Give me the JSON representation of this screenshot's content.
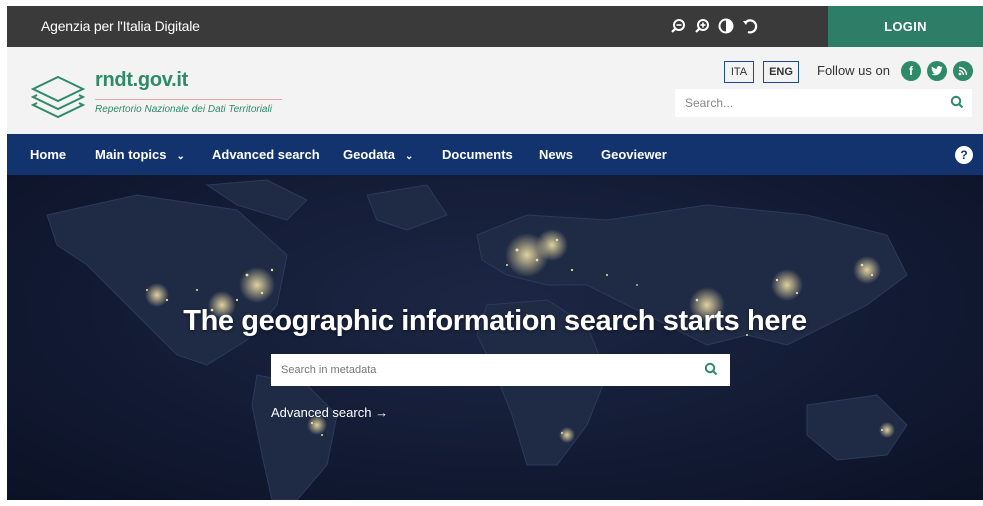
{
  "topbar": {
    "agency": "Agenzia per l'Italia Digitale",
    "login": "LOGIN",
    "icons": [
      "zoom-out-icon",
      "zoom-in-icon",
      "contrast-icon",
      "reset-icon"
    ]
  },
  "header": {
    "site_title": "rndt.gov.it",
    "site_subtitle": "Repertorio Nazionale dei Dati Territoriali",
    "lang_ita": "ITA",
    "lang_eng": "ENG",
    "follow_label": "Follow us on",
    "social": [
      "facebook-icon",
      "twitter-icon",
      "rss-icon"
    ],
    "search_placeholder": "Search..."
  },
  "nav": {
    "items": [
      {
        "label": "Home"
      },
      {
        "label": "Main topics",
        "dropdown": true
      },
      {
        "label": "Advanced search"
      },
      {
        "label": "Geodata",
        "dropdown": true
      },
      {
        "label": "Documents"
      },
      {
        "label": "News"
      },
      {
        "label": "Geoviewer"
      }
    ],
    "help": "?"
  },
  "hero": {
    "title": "The geographic information search starts here",
    "search_placeholder": "Search in metadata",
    "advanced_link": "Advanced search →"
  },
  "colors": {
    "topbar_bg": "#3a3a3a",
    "login_bg": "#2e7d66",
    "brand_green": "#2e8a68",
    "nav_bg": "#12336e"
  }
}
